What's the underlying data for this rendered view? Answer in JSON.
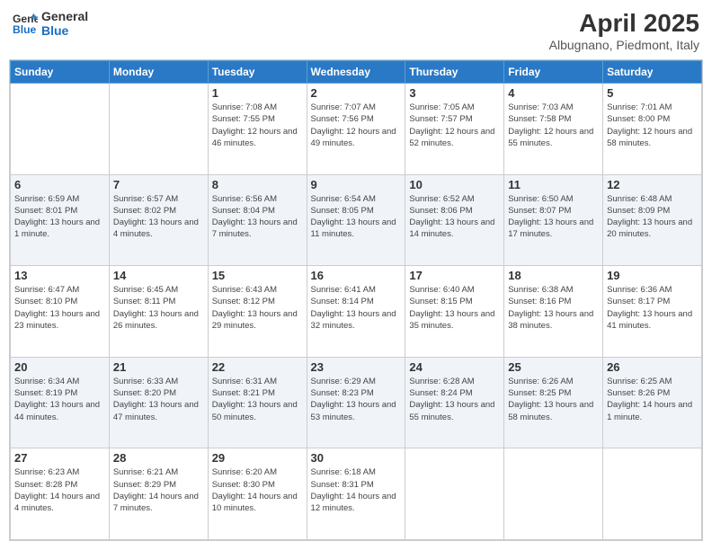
{
  "header": {
    "logo_line1": "General",
    "logo_line2": "Blue",
    "title": "April 2025",
    "subtitle": "Albugnano, Piedmont, Italy"
  },
  "days_of_week": [
    "Sunday",
    "Monday",
    "Tuesday",
    "Wednesday",
    "Thursday",
    "Friday",
    "Saturday"
  ],
  "weeks": [
    [
      {
        "day": "",
        "info": ""
      },
      {
        "day": "",
        "info": ""
      },
      {
        "day": "1",
        "info": "Sunrise: 7:08 AM\nSunset: 7:55 PM\nDaylight: 12 hours and 46 minutes."
      },
      {
        "day": "2",
        "info": "Sunrise: 7:07 AM\nSunset: 7:56 PM\nDaylight: 12 hours and 49 minutes."
      },
      {
        "day": "3",
        "info": "Sunrise: 7:05 AM\nSunset: 7:57 PM\nDaylight: 12 hours and 52 minutes."
      },
      {
        "day": "4",
        "info": "Sunrise: 7:03 AM\nSunset: 7:58 PM\nDaylight: 12 hours and 55 minutes."
      },
      {
        "day": "5",
        "info": "Sunrise: 7:01 AM\nSunset: 8:00 PM\nDaylight: 12 hours and 58 minutes."
      }
    ],
    [
      {
        "day": "6",
        "info": "Sunrise: 6:59 AM\nSunset: 8:01 PM\nDaylight: 13 hours and 1 minute."
      },
      {
        "day": "7",
        "info": "Sunrise: 6:57 AM\nSunset: 8:02 PM\nDaylight: 13 hours and 4 minutes."
      },
      {
        "day": "8",
        "info": "Sunrise: 6:56 AM\nSunset: 8:04 PM\nDaylight: 13 hours and 7 minutes."
      },
      {
        "day": "9",
        "info": "Sunrise: 6:54 AM\nSunset: 8:05 PM\nDaylight: 13 hours and 11 minutes."
      },
      {
        "day": "10",
        "info": "Sunrise: 6:52 AM\nSunset: 8:06 PM\nDaylight: 13 hours and 14 minutes."
      },
      {
        "day": "11",
        "info": "Sunrise: 6:50 AM\nSunset: 8:07 PM\nDaylight: 13 hours and 17 minutes."
      },
      {
        "day": "12",
        "info": "Sunrise: 6:48 AM\nSunset: 8:09 PM\nDaylight: 13 hours and 20 minutes."
      }
    ],
    [
      {
        "day": "13",
        "info": "Sunrise: 6:47 AM\nSunset: 8:10 PM\nDaylight: 13 hours and 23 minutes."
      },
      {
        "day": "14",
        "info": "Sunrise: 6:45 AM\nSunset: 8:11 PM\nDaylight: 13 hours and 26 minutes."
      },
      {
        "day": "15",
        "info": "Sunrise: 6:43 AM\nSunset: 8:12 PM\nDaylight: 13 hours and 29 minutes."
      },
      {
        "day": "16",
        "info": "Sunrise: 6:41 AM\nSunset: 8:14 PM\nDaylight: 13 hours and 32 minutes."
      },
      {
        "day": "17",
        "info": "Sunrise: 6:40 AM\nSunset: 8:15 PM\nDaylight: 13 hours and 35 minutes."
      },
      {
        "day": "18",
        "info": "Sunrise: 6:38 AM\nSunset: 8:16 PM\nDaylight: 13 hours and 38 minutes."
      },
      {
        "day": "19",
        "info": "Sunrise: 6:36 AM\nSunset: 8:17 PM\nDaylight: 13 hours and 41 minutes."
      }
    ],
    [
      {
        "day": "20",
        "info": "Sunrise: 6:34 AM\nSunset: 8:19 PM\nDaylight: 13 hours and 44 minutes."
      },
      {
        "day": "21",
        "info": "Sunrise: 6:33 AM\nSunset: 8:20 PM\nDaylight: 13 hours and 47 minutes."
      },
      {
        "day": "22",
        "info": "Sunrise: 6:31 AM\nSunset: 8:21 PM\nDaylight: 13 hours and 50 minutes."
      },
      {
        "day": "23",
        "info": "Sunrise: 6:29 AM\nSunset: 8:23 PM\nDaylight: 13 hours and 53 minutes."
      },
      {
        "day": "24",
        "info": "Sunrise: 6:28 AM\nSunset: 8:24 PM\nDaylight: 13 hours and 55 minutes."
      },
      {
        "day": "25",
        "info": "Sunrise: 6:26 AM\nSunset: 8:25 PM\nDaylight: 13 hours and 58 minutes."
      },
      {
        "day": "26",
        "info": "Sunrise: 6:25 AM\nSunset: 8:26 PM\nDaylight: 14 hours and 1 minute."
      }
    ],
    [
      {
        "day": "27",
        "info": "Sunrise: 6:23 AM\nSunset: 8:28 PM\nDaylight: 14 hours and 4 minutes."
      },
      {
        "day": "28",
        "info": "Sunrise: 6:21 AM\nSunset: 8:29 PM\nDaylight: 14 hours and 7 minutes."
      },
      {
        "day": "29",
        "info": "Sunrise: 6:20 AM\nSunset: 8:30 PM\nDaylight: 14 hours and 10 minutes."
      },
      {
        "day": "30",
        "info": "Sunrise: 6:18 AM\nSunset: 8:31 PM\nDaylight: 14 hours and 12 minutes."
      },
      {
        "day": "",
        "info": ""
      },
      {
        "day": "",
        "info": ""
      },
      {
        "day": "",
        "info": ""
      }
    ]
  ]
}
